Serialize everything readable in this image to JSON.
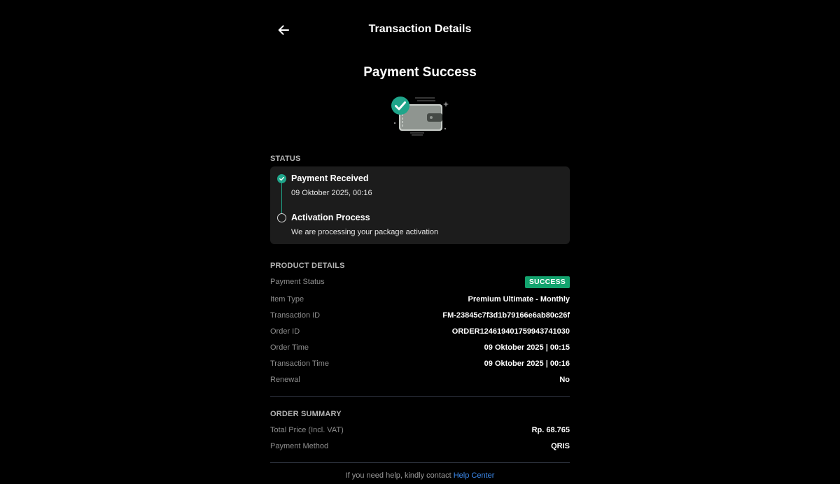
{
  "header": {
    "title": "Transaction Details"
  },
  "hero": {
    "title": "Payment Success"
  },
  "status": {
    "section_label": "STATUS",
    "steps": [
      {
        "title": "Payment Received",
        "subtitle": "09 Oktober 2025, 00:16",
        "state": "done"
      },
      {
        "title": "Activation Process",
        "subtitle": "We are processing your package activation",
        "state": "pending"
      }
    ]
  },
  "product_details": {
    "section_label": "PRODUCT DETAILS",
    "rows": [
      {
        "label": "Payment Status",
        "value": "SUCCESS"
      },
      {
        "label": "Item Type",
        "value": "Premium Ultimate - Monthly"
      },
      {
        "label": "Transaction ID",
        "value": "FM-23845c7f3d1b79166e6ab80c26f"
      },
      {
        "label": "Order ID",
        "value": "ORDER124619401759943741030"
      },
      {
        "label": "Order Time",
        "value": "09 Oktober 2025 | 00:15"
      },
      {
        "label": "Transaction Time",
        "value": "09 Oktober 2025 | 00:16"
      },
      {
        "label": "Renewal",
        "value": "No"
      }
    ]
  },
  "order_summary": {
    "section_label": "ORDER SUMMARY",
    "rows": [
      {
        "label": "Total Price (Incl. VAT)",
        "value": "Rp. 68.765"
      },
      {
        "label": "Payment Method",
        "value": "QRIS"
      }
    ]
  },
  "footer": {
    "help_text": "If you need help, kindly contact",
    "help_link": "Help Center"
  },
  "colors": {
    "accent_teal": "#1fa58a",
    "success_badge": "#13a36e",
    "link": "#3d8cf0",
    "card_bg": "#1c1c1c"
  },
  "icons": {
    "back": "arrow-left-icon",
    "hero": "wallet-check-icon"
  }
}
